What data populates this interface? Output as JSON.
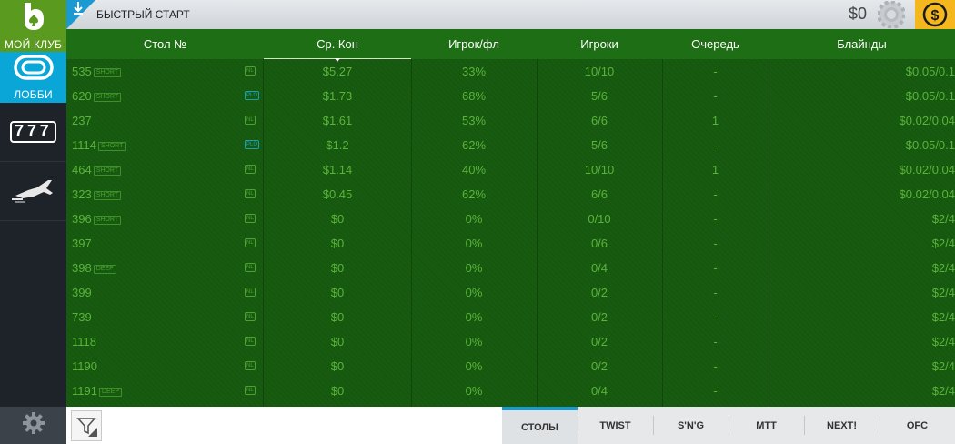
{
  "sidebar": {
    "club_label": "МОЙ КЛУБ",
    "lobby_label": "ЛОББИ",
    "slots_label": "777"
  },
  "topbar": {
    "quick_start_label": "БЫСТРЫЙ СТАРТ",
    "balance": "$0"
  },
  "table": {
    "headers": [
      "Стол №",
      "Ср. Кон",
      "Игрок/фл",
      "Игроки",
      "Очередь",
      "Блайнды"
    ],
    "sorted_column": "Ср. Кон",
    "rows": [
      {
        "id": "535",
        "tag": "SHORT",
        "game": "NL",
        "pot": "$5.27",
        "ppf": "33%",
        "players": "10/10",
        "queue": "-",
        "blinds": "$0.05/0.1"
      },
      {
        "id": "620",
        "tag": "SHORT",
        "game": "PLO",
        "pot": "$1.73",
        "ppf": "68%",
        "players": "5/6",
        "queue": "-",
        "blinds": "$0.05/0.1"
      },
      {
        "id": "237",
        "tag": "",
        "game": "NL",
        "pot": "$1.61",
        "ppf": "53%",
        "players": "6/6",
        "queue": "1",
        "blinds": "$0.02/0.04"
      },
      {
        "id": "1114",
        "tag": "SHORT",
        "game": "PLO",
        "pot": "$1.2",
        "ppf": "62%",
        "players": "5/6",
        "queue": "-",
        "blinds": "$0.05/0.1"
      },
      {
        "id": "464",
        "tag": "SHORT",
        "game": "NL",
        "pot": "$1.14",
        "ppf": "40%",
        "players": "10/10",
        "queue": "1",
        "blinds": "$0.02/0.04"
      },
      {
        "id": "323",
        "tag": "SHORT",
        "game": "NL",
        "pot": "$0.45",
        "ppf": "62%",
        "players": "6/6",
        "queue": "-",
        "blinds": "$0.02/0.04"
      },
      {
        "id": "396",
        "tag": "SHORT",
        "game": "NL",
        "pot": "$0",
        "ppf": "0%",
        "players": "0/10",
        "queue": "-",
        "blinds": "$2/4"
      },
      {
        "id": "397",
        "tag": "",
        "game": "NL",
        "pot": "$0",
        "ppf": "0%",
        "players": "0/6",
        "queue": "-",
        "blinds": "$2/4"
      },
      {
        "id": "398",
        "tag": "DEEP",
        "game": "NL",
        "pot": "$0",
        "ppf": "0%",
        "players": "0/4",
        "queue": "-",
        "blinds": "$2/4"
      },
      {
        "id": "399",
        "tag": "",
        "game": "NL",
        "pot": "$0",
        "ppf": "0%",
        "players": "0/2",
        "queue": "-",
        "blinds": "$2/4"
      },
      {
        "id": "739",
        "tag": "",
        "game": "NL",
        "pot": "$0",
        "ppf": "0%",
        "players": "0/2",
        "queue": "-",
        "blinds": "$2/4"
      },
      {
        "id": "1118",
        "tag": "",
        "game": "NL",
        "pot": "$0",
        "ppf": "0%",
        "players": "0/2",
        "queue": "-",
        "blinds": "$2/4"
      },
      {
        "id": "1190",
        "tag": "",
        "game": "NL",
        "pot": "$0",
        "ppf": "0%",
        "players": "0/2",
        "queue": "-",
        "blinds": "$2/4"
      },
      {
        "id": "1191",
        "tag": "DEEP",
        "game": "NL",
        "pot": "$0",
        "ppf": "0%",
        "players": "0/4",
        "queue": "-",
        "blinds": "$2/4"
      }
    ]
  },
  "bottom_tabs": {
    "items": [
      "СТОЛЫ",
      "TWIST",
      "S'N'G",
      "MTT",
      "NEXT!",
      "OFC"
    ],
    "active": "СТОЛЫ"
  },
  "icons": {
    "club": "club-logo-icon",
    "lobby": "tables-icon",
    "slots": "slots-777-icon",
    "aviator": "airplane-icon",
    "settings": "gear-icon",
    "quick_start": "download-arrow-icon",
    "chip": "poker-chip-icon",
    "cashier": "dollar-coin-icon",
    "filter": "filter-funnel-icon"
  },
  "colors": {
    "club_green": "#5a9a1e",
    "lobby_blue": "#0aa6d8",
    "table_green": "#175b10",
    "text_green": "#5bb33a",
    "cashier_yellow": "#f4b71e",
    "tab_accent": "#1b9ad1"
  }
}
